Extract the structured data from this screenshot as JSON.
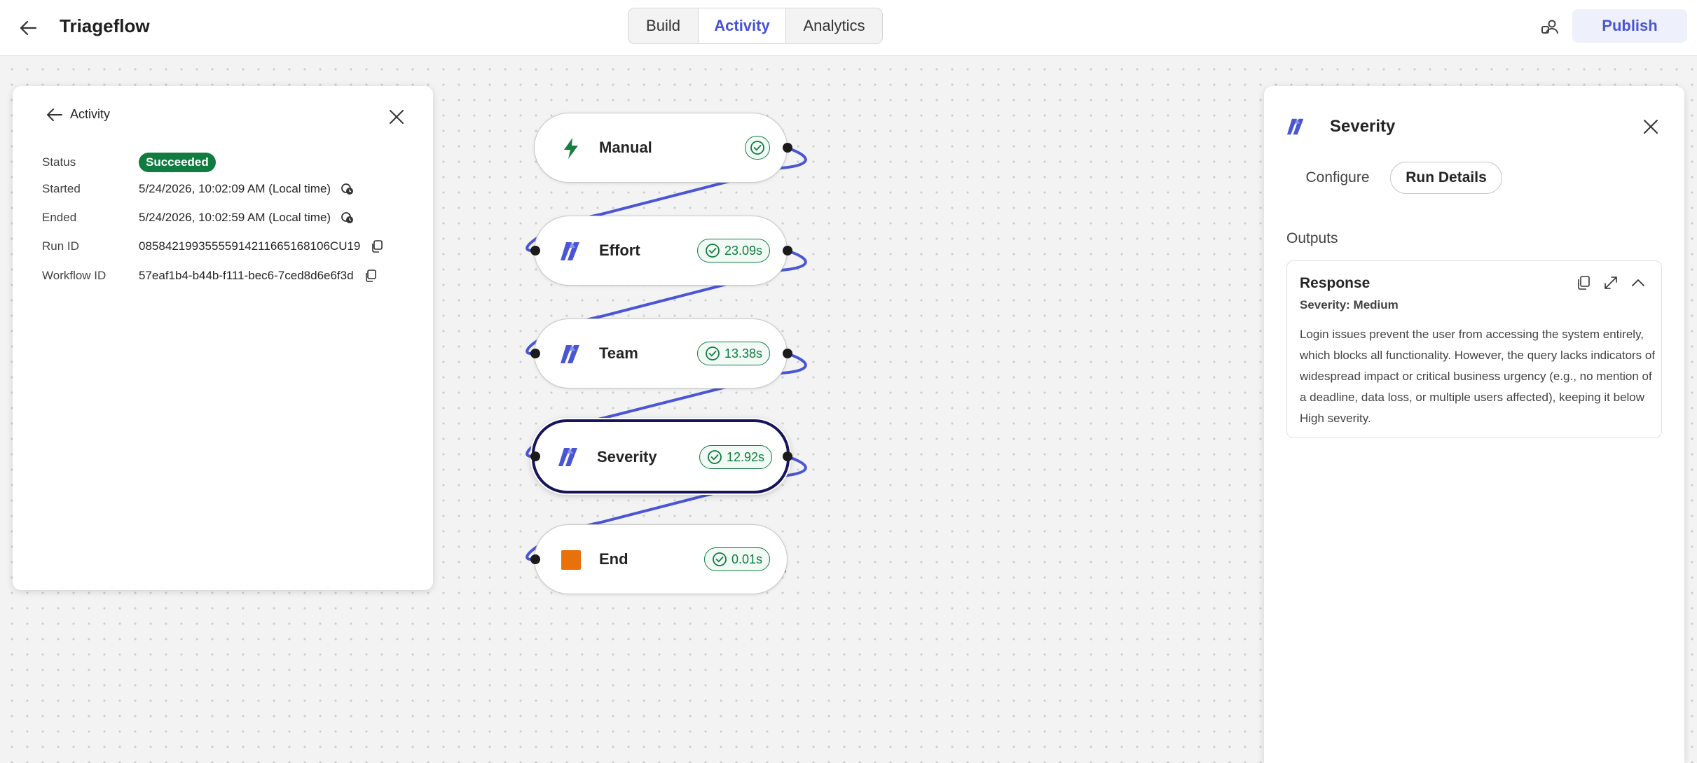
{
  "header": {
    "title": "Triageflow",
    "tabs": [
      {
        "label": "Build"
      },
      {
        "label": "Activity"
      },
      {
        "label": "Analytics"
      }
    ],
    "active_tab": "Activity",
    "publish_label": "Publish",
    "accent_color": "#4352d6"
  },
  "activity_panel": {
    "back_label": "Activity",
    "rows": [
      {
        "label": "Status",
        "value": "Succeeded"
      },
      {
        "label": "Started",
        "value": "5/24/2026, 10:02:09 AM (Local time)"
      },
      {
        "label": "Ended",
        "value": "5/24/2026, 10:02:59 AM (Local time)"
      },
      {
        "label": "Run ID",
        "value": "08584219935555914211665168106CU19"
      },
      {
        "label": "Workflow ID",
        "value": "57eaf1b4-b44b-f111-bec6-7ced8d6e6f3d"
      }
    ],
    "status_color": "#107c41"
  },
  "flow": {
    "nodes": [
      {
        "label": "Manual",
        "icon": "lightning-icon",
        "duration": ""
      },
      {
        "label": "Effort",
        "icon": "ai-model-icon",
        "duration": "23.09s"
      },
      {
        "label": "Team",
        "icon": "ai-model-icon",
        "duration": "13.38s"
      },
      {
        "label": "Severity",
        "icon": "ai-model-icon",
        "duration": "12.92s",
        "selected": true
      },
      {
        "label": "End",
        "icon": "stop-square-icon",
        "duration": "0.01s"
      }
    ],
    "connector_color": "#4a55d6"
  },
  "details_panel": {
    "title": "Severity",
    "tabs": [
      {
        "label": "Configure"
      },
      {
        "label": "Run Details"
      }
    ],
    "active_tab": "Run Details",
    "outputs_label": "Outputs",
    "response": {
      "title": "Response",
      "subtitle": "Severity: Medium",
      "body": "Login issues prevent the user from accessing the system entirely, which blocks all functionality. However, the query lacks indicators of widespread impact or critical business urgency (e.g., no mention of a deadline, data loss, or multiple users affected), keeping it below High severity."
    }
  }
}
